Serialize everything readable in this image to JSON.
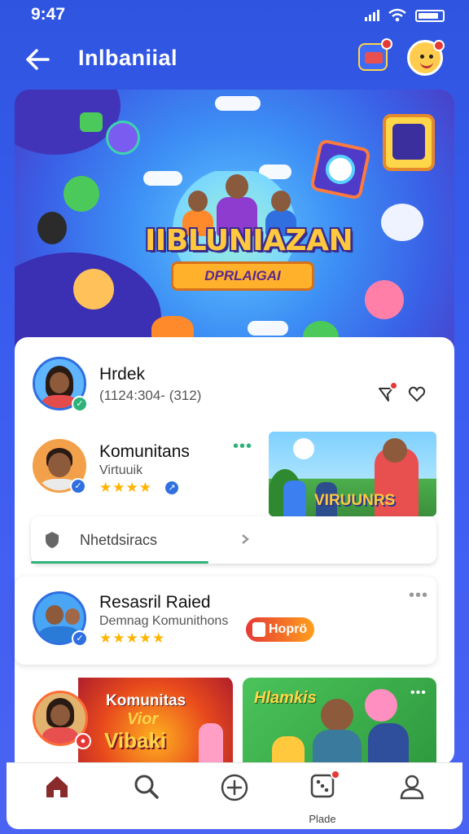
{
  "status_bar": {
    "time": "9:47"
  },
  "header": {
    "title": "Inlbaniial"
  },
  "banner": {
    "title": "IIBLUNIAZAN",
    "subtitle": "DPRLAIGAI"
  },
  "profile": {
    "name": "Hrdek",
    "detail": "(1124:304- (312)"
  },
  "community": {
    "name": "Komunitans",
    "subtitle": "Virtuuik",
    "stars": "★★★★",
    "thumb_label": "VIRUUNRS"
  },
  "search": {
    "placeholder": "Nhetdsiracs"
  },
  "card": {
    "title": "Resasril Raied",
    "subtitle": "Demnag Komunithons",
    "stars": "★★★★★",
    "pill_label": "Hoprö"
  },
  "tiles": [
    {
      "title": "Komunitas",
      "line2": "Vior",
      "line3": "Vibaki"
    },
    {
      "title": "Hlamkis"
    }
  ],
  "bottom_nav": {
    "center_label": "Plade"
  },
  "colors": {
    "accent": "#3b5df0",
    "primary_blue": "#2f6fe0",
    "success": "#2db37a",
    "star": "#ffb400",
    "alert": "#e53935"
  },
  "icons": [
    "back-arrow-icon",
    "wallet-icon",
    "avatar-icon",
    "message-icon",
    "heart-icon",
    "more-icon",
    "shield-icon",
    "chevron-icon",
    "home-icon",
    "search-icon",
    "add-icon",
    "dice-icon",
    "profile-icon"
  ]
}
